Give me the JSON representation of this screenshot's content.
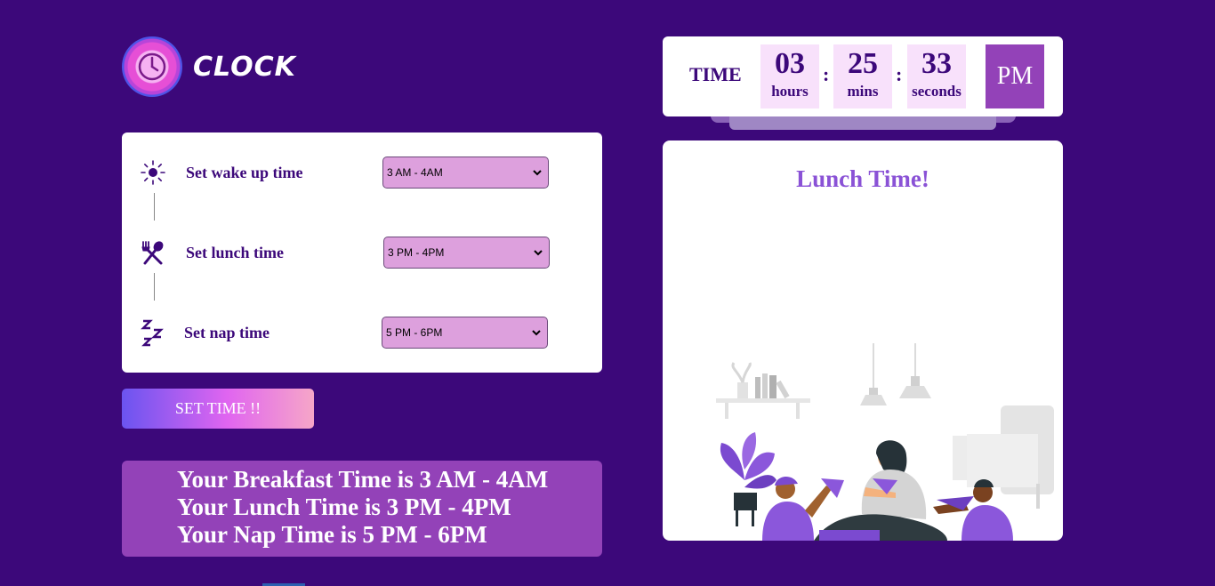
{
  "app": {
    "logo_text": "CLOCK"
  },
  "settings": {
    "rows": [
      {
        "label": "Set wake up time",
        "selected": "3 AM - 4AM",
        "icon": "sun-icon"
      },
      {
        "label": "Set lunch time",
        "selected": "3 PM - 4PM",
        "icon": "fork-spoon-icon"
      },
      {
        "label": "Set nap time",
        "selected": "5 PM - 6PM",
        "icon": "sleep-zzz-icon"
      }
    ],
    "button_label": "SET TIME !!"
  },
  "summary": {
    "lines": [
      "Your Breakfast Time is 3 AM - 4AM",
      "Your Lunch Time is 3 PM - 4PM",
      "Your Nap Time is 5 PM - 6PM"
    ]
  },
  "clock": {
    "label": "TIME",
    "hours": "03",
    "hours_unit": "hours",
    "mins": "25",
    "mins_unit": "mins",
    "seconds": "33",
    "seconds_unit": "seconds",
    "separator": ":",
    "ampm": "PM"
  },
  "message": {
    "title": "Lunch Time!"
  },
  "colors": {
    "background": "#3c087a",
    "accent": "#9342b8",
    "select_bg": "#dda0dd",
    "title": "#8a52d6"
  }
}
